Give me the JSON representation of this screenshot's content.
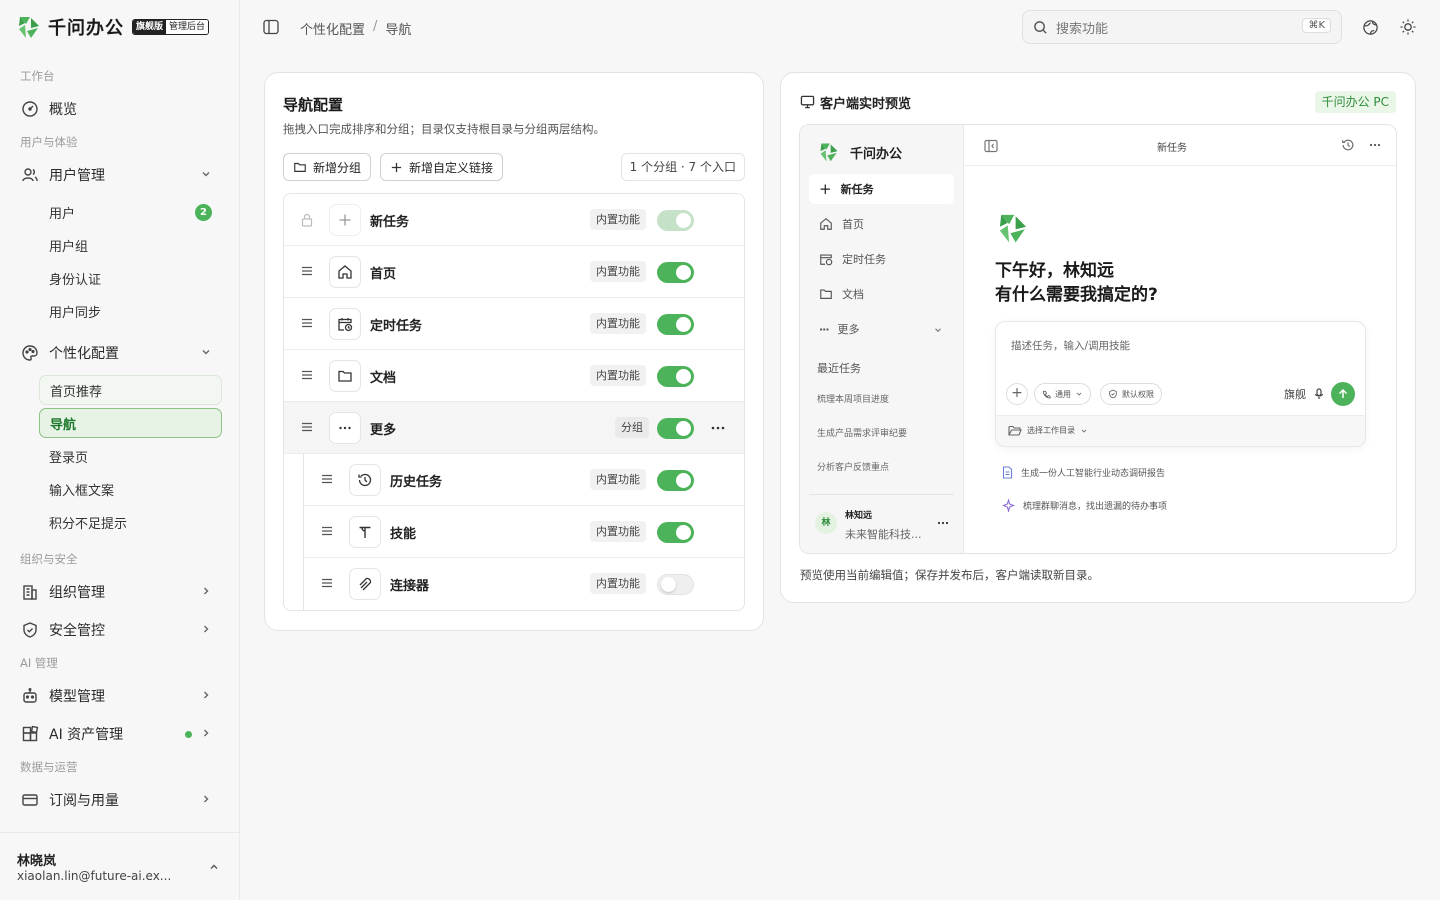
{
  "brand": {
    "name": "千问办公",
    "badge_edition": "旗舰版",
    "badge_admin": "管理后台",
    "accent": "#4cb35a"
  },
  "sidebar": {
    "sections": {
      "workspace": "工作台",
      "users": "用户与体验",
      "org": "组织与安全",
      "ai": "AI 管理",
      "data": "数据与运营"
    },
    "items": {
      "overview": "概览",
      "user_mgmt": "用户管理",
      "personalize": "个性化配置",
      "org_mgmt": "组织管理",
      "security": "安全管控",
      "model_mgmt": "模型管理",
      "ai_assets": "AI 资产管理",
      "billing": "订阅与用量"
    },
    "user_sub": {
      "users": "用户",
      "users_count": "2",
      "groups": "用户组",
      "auth": "身份认证",
      "sync": "用户同步"
    },
    "personal_sub": {
      "home_rec": "首页推荐",
      "nav": "导航",
      "login": "登录页",
      "input_copy": "输入框文案",
      "credit_hint": "积分不足提示"
    },
    "user": {
      "name": "林晓岚",
      "email": "xiaolan.lin@future-ai.ex..."
    }
  },
  "topbar": {
    "crumb_parent": "个性化配置",
    "crumb_sep": "/",
    "crumb_current": "导航",
    "search_placeholder": "搜索功能",
    "search_kbd": "⌘K"
  },
  "nav_config": {
    "title": "导航配置",
    "desc": "拖拽入口完成排序和分组；目录仅支持根目录与分组两层结构。",
    "add_group": "新增分组",
    "add_link": "新增自定义链接",
    "summary": "1 个分组 · 7 个入口",
    "rows": [
      {
        "label": "新任务",
        "tag": "内置功能",
        "enabled": true,
        "locked": true
      },
      {
        "label": "首页",
        "tag": "内置功能",
        "enabled": true
      },
      {
        "label": "定时任务",
        "tag": "内置功能",
        "enabled": true
      },
      {
        "label": "文档",
        "tag": "内置功能",
        "enabled": true
      },
      {
        "label": "更多",
        "tag": "分组",
        "enabled": true
      },
      {
        "label": "历史任务",
        "tag": "内置功能",
        "enabled": true
      },
      {
        "label": "技能",
        "tag": "内置功能",
        "enabled": true
      },
      {
        "label": "连接器",
        "tag": "内置功能",
        "enabled": false
      }
    ]
  },
  "preview": {
    "title": "客户端实时预览",
    "platform": "千问办公 PC",
    "app_name": "千问办公",
    "header_title": "新任务",
    "nav": {
      "new_task": "新任务",
      "home": "首页",
      "scheduled": "定时任务",
      "docs": "文档",
      "more": "更多"
    },
    "recent_title": "最近任务",
    "recent": [
      "梳理本周项目进度",
      "生成产品需求评审纪要",
      "分析客户反馈重点"
    ],
    "user_initial": "林",
    "user_name": "林知远",
    "user_org": "未来智能科技...",
    "greeting_line1": "下午好，林知远",
    "greeting_line2": "有什么需要我搞定的?",
    "input_placeholder": "描述任务，输入/调用技能",
    "chip_general": "通用",
    "chip_perm": "默认权限",
    "model": "旗舰",
    "workdir": "选择工作目录",
    "suggestions": [
      "生成一份人工智能行业动态调研报告",
      "梳理群聊消息，找出遗漏的待办事项"
    ],
    "note": "预览使用当前编辑值；保存并发布后，客户端读取新目录。"
  }
}
